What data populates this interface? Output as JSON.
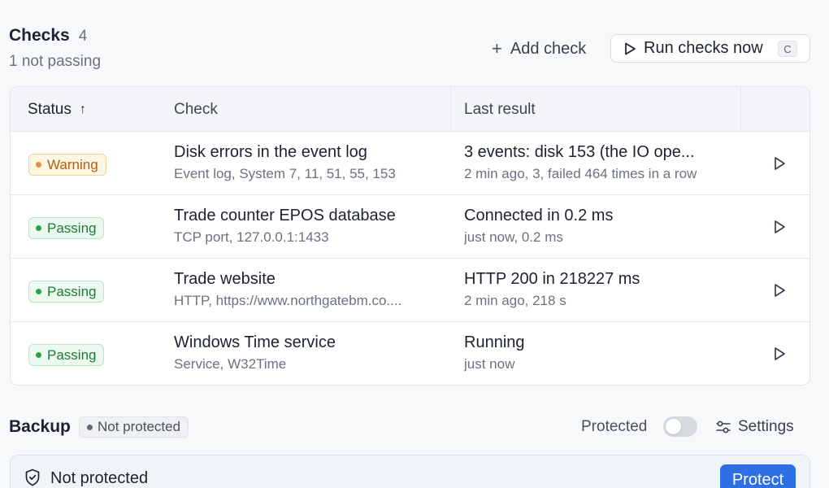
{
  "checks": {
    "title": "Checks",
    "count": "4",
    "subtitle": "1 not passing",
    "add_label": "Add check",
    "run_label": "Run checks now",
    "run_shortcut": "C",
    "columns": {
      "status": "Status",
      "check": "Check",
      "result": "Last result"
    },
    "rows": [
      {
        "status": "Warning",
        "status_kind": "warning",
        "title": "Disk errors in the event log",
        "detail": "Event log, System 7, 11, 51, 55, 153",
        "result": "3 events: disk 153 (the IO ope...",
        "result_detail": "2 min ago, 3, failed 464 times in a row"
      },
      {
        "status": "Passing",
        "status_kind": "passing",
        "title": "Trade counter EPOS database",
        "detail": "TCP port, 127.0.0.1:1433",
        "result": "Connected in 0.2 ms",
        "result_detail": "just now, 0.2 ms"
      },
      {
        "status": "Passing",
        "status_kind": "passing",
        "title": "Trade website",
        "detail": "HTTP, https://www.northgatebm.co....",
        "result": "HTTP 200 in 218227 ms",
        "result_detail": "2 min ago, 218 s"
      },
      {
        "status": "Passing",
        "status_kind": "passing",
        "title": "Windows Time service",
        "detail": "Service, W32Time",
        "result": "Running",
        "result_detail": "just now"
      }
    ]
  },
  "backup": {
    "title": "Backup",
    "badge": "Not protected",
    "toggle_label": "Protected",
    "toggle_on": false,
    "settings_label": "Settings",
    "banner_text": "Not protected",
    "protect_label": "Protect"
  },
  "colors": {
    "accent": "#2f6fe4",
    "warning": "#b15e12",
    "passing": "#1e7a3a"
  }
}
